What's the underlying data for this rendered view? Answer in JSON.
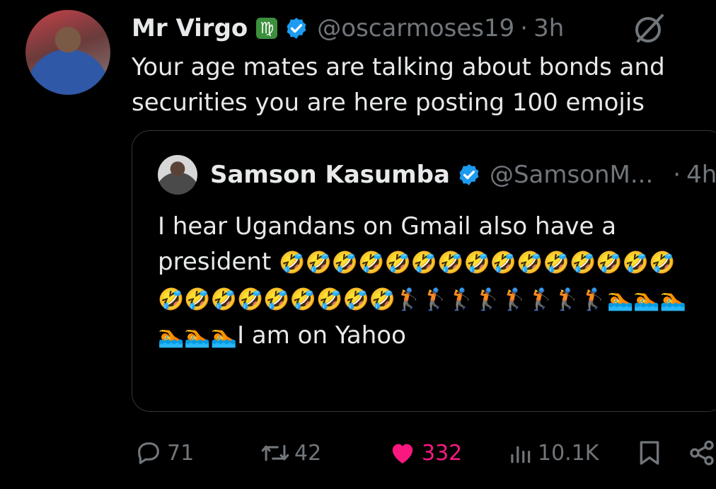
{
  "tweet": {
    "author_name": "Mr Virgo",
    "author_badge_emoji": "♍",
    "handle": "@oscarmoses19",
    "separator": "·",
    "time": "3h",
    "text": "Your age mates are talking about bonds and securities you are here posting 100 emojis"
  },
  "quoted_tweet": {
    "author_name": "Samson Kasumba",
    "handle": "@SamsonM...",
    "separator": "·",
    "time": "4h",
    "text_intro": "I hear Ugandans on Gmail also have a president",
    "emojis": "🤣🤣🤣🤣🤣🤣🤣🤣🤣🤣🤣🤣🤣🤣🤣🤣🤣🤣🤣🤣🤣🤣🤣🤣🏌️🏌️🏌️🏌️🏌️🏌️🏌️🏌️🏊🏊🏊🏊🏊🏊",
    "text_outro": "I am on Yahoo"
  },
  "actions": {
    "replies": "71",
    "reposts": "42",
    "likes": "332",
    "views": "10.1K"
  },
  "icons": {
    "reply": "reply-icon",
    "repost": "repost-icon",
    "like": "heart-icon",
    "views": "views-icon",
    "bookmark": "bookmark-icon",
    "share": "share-icon",
    "grok": "grok-icon",
    "verified": "verified-badge-icon"
  },
  "colors": {
    "background": "#000000",
    "text": "#e7e9ea",
    "muted": "#71767b",
    "verified": "#1d9bf0",
    "like": "#f91880"
  }
}
